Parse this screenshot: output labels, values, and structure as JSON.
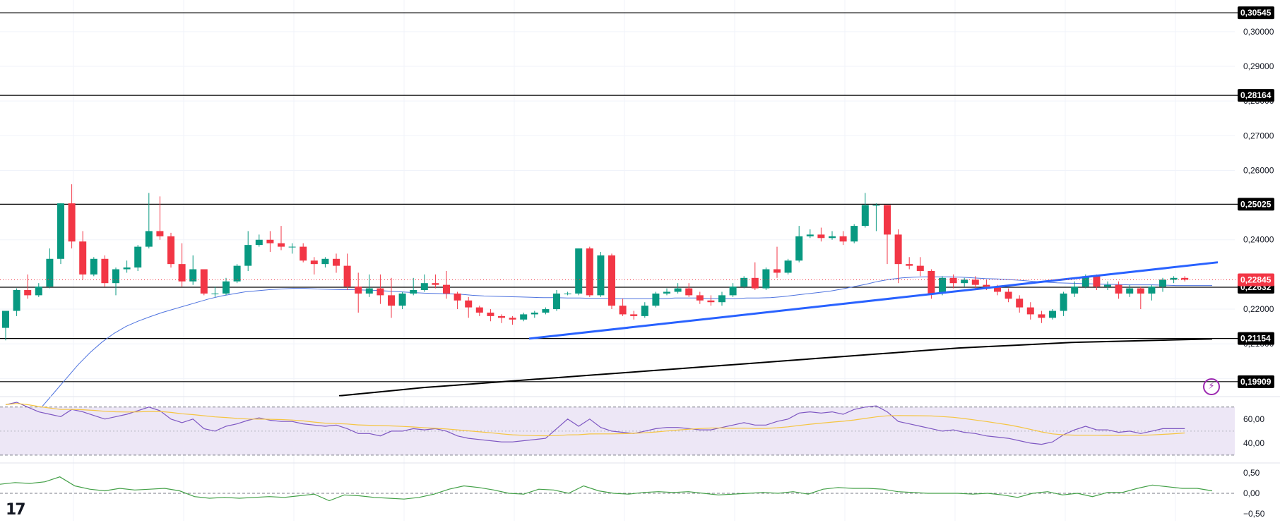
{
  "chart_data": {
    "type": "candlestick",
    "price_axis": {
      "ticks": [
        "0,30000",
        "0,29000",
        "0,28000",
        "0,27000",
        "0,26000",
        "0,24000",
        "0,22000",
        "0,21000",
        "0,20000"
      ],
      "range": [
        0.196,
        0.3075
      ]
    },
    "levels": [
      {
        "label": "0,30545",
        "value": 0.30545
      },
      {
        "label": "0,28164",
        "value": 0.28164
      },
      {
        "label": "0,25025",
        "value": 0.25025
      },
      {
        "label": "0,22632",
        "value": 0.22632
      },
      {
        "label": "0,21154",
        "value": 0.21154
      },
      {
        "label": "0,19909",
        "value": 0.19909
      }
    ],
    "current_price": {
      "label": "0,22845",
      "value": 0.22845
    },
    "candles": [
      [
        0.2146,
        0.2195,
        0.211,
        0.2195
      ],
      [
        0.2195,
        0.2255,
        0.218,
        0.226
      ],
      [
        0.2255,
        0.224,
        0.223,
        0.23
      ],
      [
        0.224,
        0.2265,
        0.2235,
        0.2275
      ],
      [
        0.2265,
        0.2345,
        0.226,
        0.2375
      ],
      [
        0.2345,
        0.2505,
        0.233,
        0.2505
      ],
      [
        0.2505,
        0.2395,
        0.2375,
        0.256
      ],
      [
        0.2395,
        0.23,
        0.2285,
        0.2425
      ],
      [
        0.23,
        0.2345,
        0.2295,
        0.235
      ],
      [
        0.2345,
        0.2275,
        0.2265,
        0.2355
      ],
      [
        0.2275,
        0.2315,
        0.224,
        0.232
      ],
      [
        0.2315,
        0.232,
        0.2305,
        0.234
      ],
      [
        0.232,
        0.238,
        0.231,
        0.2385
      ],
      [
        0.238,
        0.2425,
        0.2375,
        0.2535
      ],
      [
        0.2425,
        0.241,
        0.24,
        0.2525
      ],
      [
        0.241,
        0.233,
        0.232,
        0.242
      ],
      [
        0.233,
        0.228,
        0.2265,
        0.239
      ],
      [
        0.228,
        0.2315,
        0.227,
        0.2355
      ],
      [
        0.2315,
        0.2245,
        0.224,
        0.231
      ],
      [
        0.2245,
        0.2245,
        0.2235,
        0.2265
      ],
      [
        0.2245,
        0.228,
        0.224,
        0.229
      ],
      [
        0.228,
        0.2325,
        0.2275,
        0.233
      ],
      [
        0.2325,
        0.2385,
        0.231,
        0.2425
      ],
      [
        0.2385,
        0.24,
        0.238,
        0.2415
      ],
      [
        0.24,
        0.239,
        0.2365,
        0.2425
      ],
      [
        0.239,
        0.238,
        0.237,
        0.244
      ],
      [
        0.238,
        0.238,
        0.236,
        0.239
      ],
      [
        0.238,
        0.234,
        0.2335,
        0.239
      ],
      [
        0.234,
        0.233,
        0.23,
        0.235
      ],
      [
        0.233,
        0.2345,
        0.232,
        0.235
      ],
      [
        0.2345,
        0.2325,
        0.2305,
        0.236
      ],
      [
        0.2325,
        0.2265,
        0.2255,
        0.236
      ],
      [
        0.2265,
        0.2245,
        0.219,
        0.2305
      ],
      [
        0.2245,
        0.226,
        0.2235,
        0.23
      ],
      [
        0.226,
        0.224,
        0.2215,
        0.23
      ],
      [
        0.224,
        0.221,
        0.2175,
        0.229
      ],
      [
        0.221,
        0.2245,
        0.22,
        0.225
      ],
      [
        0.2245,
        0.2255,
        0.224,
        0.229
      ],
      [
        0.2255,
        0.2275,
        0.225,
        0.23
      ],
      [
        0.2275,
        0.227,
        0.226,
        0.23
      ],
      [
        0.227,
        0.2245,
        0.223,
        0.231
      ],
      [
        0.2245,
        0.2225,
        0.22,
        0.225
      ],
      [
        0.2225,
        0.2205,
        0.2175,
        0.2235
      ],
      [
        0.2205,
        0.219,
        0.218,
        0.221
      ],
      [
        0.219,
        0.218,
        0.2165,
        0.22
      ],
      [
        0.218,
        0.2175,
        0.216,
        0.2185
      ],
      [
        0.2175,
        0.217,
        0.2155,
        0.218
      ],
      [
        0.217,
        0.2185,
        0.2165,
        0.219
      ],
      [
        0.2185,
        0.219,
        0.2175,
        0.2195
      ],
      [
        0.219,
        0.22,
        0.2185,
        0.2205
      ],
      [
        0.22,
        0.2245,
        0.2195,
        0.2255
      ],
      [
        0.2245,
        0.2245,
        0.224,
        0.225
      ],
      [
        0.2245,
        0.2375,
        0.224,
        0.2375
      ],
      [
        0.2375,
        0.224,
        0.2235,
        0.238
      ],
      [
        0.224,
        0.2355,
        0.2235,
        0.2365
      ],
      [
        0.2355,
        0.221,
        0.22,
        0.236
      ],
      [
        0.221,
        0.2185,
        0.218,
        0.223
      ],
      [
        0.2185,
        0.218,
        0.217,
        0.2195
      ],
      [
        0.218,
        0.221,
        0.2175,
        0.222
      ],
      [
        0.221,
        0.2245,
        0.2205,
        0.225
      ],
      [
        0.2245,
        0.225,
        0.224,
        0.226
      ],
      [
        0.225,
        0.226,
        0.2245,
        0.2275
      ],
      [
        0.226,
        0.224,
        0.2235,
        0.2275
      ],
      [
        0.224,
        0.2225,
        0.2215,
        0.225
      ],
      [
        0.2225,
        0.222,
        0.221,
        0.224
      ],
      [
        0.222,
        0.224,
        0.221,
        0.225
      ],
      [
        0.224,
        0.2265,
        0.2235,
        0.2275
      ],
      [
        0.2265,
        0.229,
        0.226,
        0.2295
      ],
      [
        0.229,
        0.226,
        0.2255,
        0.2335
      ],
      [
        0.226,
        0.2315,
        0.2255,
        0.232
      ],
      [
        0.2315,
        0.2305,
        0.229,
        0.238
      ],
      [
        0.2305,
        0.234,
        0.23,
        0.2345
      ],
      [
        0.234,
        0.241,
        0.2335,
        0.244
      ],
      [
        0.241,
        0.2415,
        0.2405,
        0.243
      ],
      [
        0.2415,
        0.2405,
        0.2395,
        0.2435
      ],
      [
        0.2405,
        0.241,
        0.24,
        0.2425
      ],
      [
        0.241,
        0.2395,
        0.2385,
        0.2425
      ],
      [
        0.2395,
        0.244,
        0.239,
        0.2445
      ],
      [
        0.244,
        0.25,
        0.2435,
        0.2535
      ],
      [
        0.25,
        0.25,
        0.2425,
        0.2505
      ],
      [
        0.25,
        0.2415,
        0.233,
        0.25
      ],
      [
        0.2415,
        0.233,
        0.2275,
        0.243
      ],
      [
        0.233,
        0.2325,
        0.2315,
        0.235
      ],
      [
        0.2325,
        0.231,
        0.2295,
        0.235
      ],
      [
        0.231,
        0.2245,
        0.223,
        0.2315
      ],
      [
        0.2245,
        0.229,
        0.224,
        0.2295
      ],
      [
        0.229,
        0.2275,
        0.226,
        0.23
      ],
      [
        0.2275,
        0.2285,
        0.2265,
        0.229
      ],
      [
        0.2285,
        0.227,
        0.226,
        0.2295
      ],
      [
        0.227,
        0.2265,
        0.2255,
        0.2285
      ],
      [
        0.2265,
        0.225,
        0.224,
        0.227
      ],
      [
        0.225,
        0.223,
        0.222,
        0.226
      ],
      [
        0.223,
        0.2205,
        0.219,
        0.224
      ],
      [
        0.2205,
        0.2185,
        0.217,
        0.222
      ],
      [
        0.2185,
        0.2175,
        0.216,
        0.2195
      ],
      [
        0.2175,
        0.2195,
        0.217,
        0.22
      ],
      [
        0.2195,
        0.2245,
        0.218,
        0.225
      ],
      [
        0.2245,
        0.2265,
        0.2235,
        0.228
      ],
      [
        0.2265,
        0.2295,
        0.226,
        0.23
      ],
      [
        0.2295,
        0.2265,
        0.2255,
        0.23
      ],
      [
        0.2265,
        0.227,
        0.2255,
        0.228
      ],
      [
        0.227,
        0.2245,
        0.223,
        0.228
      ],
      [
        0.2245,
        0.226,
        0.2235,
        0.227
      ],
      [
        0.226,
        0.2245,
        0.22,
        0.2265
      ],
      [
        0.2245,
        0.2265,
        0.2225,
        0.227
      ],
      [
        0.2265,
        0.2285,
        0.225,
        0.229
      ],
      [
        0.2285,
        0.229,
        0.2275,
        0.2295
      ],
      [
        0.229,
        0.2285,
        0.228,
        0.2295
      ]
    ],
    "sma_blue": {
      "color": "#4e73df",
      "values": [
        0.192,
        0.196,
        0.2,
        0.204,
        0.2075,
        0.2105,
        0.213,
        0.215,
        0.2165,
        0.2178,
        0.219,
        0.22,
        0.221,
        0.222,
        0.223,
        0.2238,
        0.2244,
        0.225,
        0.2253,
        0.2256,
        0.2258,
        0.226,
        0.226,
        0.2258,
        0.2257,
        0.2256,
        0.2256,
        0.2255,
        0.2254,
        0.2252,
        0.225,
        0.2248,
        0.2246,
        0.2245,
        0.2244,
        0.2243,
        0.224,
        0.2238,
        0.2237,
        0.2236,
        0.2235,
        0.2234,
        0.2233,
        0.2233,
        0.2232,
        0.2232,
        0.2231,
        0.2231,
        0.223,
        0.223,
        0.223,
        0.223,
        0.223,
        0.2232,
        0.2232,
        0.2232,
        0.223,
        0.223,
        0.223,
        0.2232,
        0.2232,
        0.2233,
        0.2236,
        0.224,
        0.2244,
        0.2248,
        0.2252,
        0.2258,
        0.2265,
        0.2272,
        0.228,
        0.2286,
        0.229,
        0.2292,
        0.2293,
        0.2293,
        0.2293,
        0.2292,
        0.229,
        0.2288,
        0.2287,
        0.2285,
        0.2283,
        0.228,
        0.2278,
        0.2276,
        0.2275,
        0.2274,
        0.2273,
        0.2272,
        0.2271,
        0.227,
        0.227,
        0.227,
        0.2269,
        0.2268,
        0.2268,
        0.2268,
        0.2268
      ]
    },
    "sma_black": {
      "color": "#000000",
      "values": [
        0.195,
        0.1958,
        0.1966,
        0.1974,
        0.198,
        0.1986,
        0.1992,
        0.1998,
        0.2004,
        0.201,
        0.2016,
        0.2022,
        0.2028,
        0.2034,
        0.204,
        0.2046,
        0.2052,
        0.2058,
        0.2064,
        0.207,
        0.2076,
        0.2082,
        0.2088,
        0.2092,
        0.2096,
        0.21,
        0.2104,
        0.2106,
        0.2108,
        0.211,
        0.2112,
        0.2114
      ]
    },
    "trendline": {
      "color": "#2962ff",
      "start": {
        "candle": 47.5,
        "value": 0.2115
      },
      "end": {
        "candle": 110.0,
        "value": 0.2335
      }
    },
    "rsi": {
      "ticks": [
        "60,00",
        "40,00"
      ],
      "range": [
        27,
        74
      ],
      "bands": [
        70,
        30
      ],
      "mid": 50,
      "line_color": "#7e57c2",
      "signal_color": "#f5c542",
      "values": [
        72,
        74,
        70,
        66,
        64,
        62,
        68,
        66,
        63,
        60,
        62,
        64,
        67,
        70,
        67,
        60,
        57,
        60,
        52,
        50,
        54,
        56,
        59,
        61,
        59,
        58,
        58,
        56,
        55,
        54,
        55,
        52,
        48,
        48,
        46,
        50,
        50,
        52,
        51,
        52,
        50,
        46,
        44,
        43,
        42,
        41,
        41,
        42,
        43,
        44,
        52,
        60,
        54,
        60,
        53,
        50,
        49,
        48,
        50,
        52,
        53,
        53,
        52,
        51,
        51,
        53,
        55,
        57,
        55,
        55,
        58,
        60,
        65,
        66,
        65,
        66,
        64,
        68,
        70,
        71,
        66,
        58,
        56,
        54,
        52,
        50,
        51,
        49,
        48,
        46,
        45,
        44,
        42,
        40,
        39,
        41,
        47,
        51,
        54,
        51,
        51,
        49,
        50,
        48,
        50,
        52,
        52,
        52
      ]
    },
    "osc": {
      "ticks": [
        "0,50",
        "0,00",
        "−0,50"
      ],
      "range": [
        -0.6,
        0.6
      ],
      "line_color": "#43a047",
      "values": [
        0.22,
        0.26,
        0.24,
        0.28,
        0.4,
        0.18,
        0.1,
        0.06,
        0.12,
        0.08,
        0.1,
        0.12,
        0.06,
        -0.08,
        -0.12,
        -0.1,
        -0.12,
        -0.1,
        -0.08,
        -0.1,
        -0.06,
        -0.02,
        -0.18,
        -0.04,
        -0.06,
        -0.1,
        -0.12,
        -0.14,
        -0.1,
        -0.02,
        0.1,
        0.18,
        0.14,
        0.08,
        0.0,
        -0.02,
        0.1,
        0.08,
        0.0,
        0.18,
        0.06,
        0.0,
        -0.02,
        0.02,
        0.04,
        0.02,
        0.04,
        0.0,
        -0.04,
        -0.02,
        0.0,
        0.02,
        0.0,
        0.04,
        -0.02,
        0.1,
        0.14,
        0.12,
        0.12,
        0.1,
        0.04,
        0.02,
        0.0,
        0.0,
        0.0,
        -0.02,
        0.0,
        -0.04,
        -0.1,
        0.0,
        0.04,
        -0.04,
        0.0,
        -0.08,
        0.02,
        0.02,
        0.12,
        0.2,
        0.16,
        0.12,
        0.12,
        0.06
      ]
    },
    "colors": {
      "up": "#089981",
      "down": "#f23645",
      "axis_text": "#131722",
      "grid": "#f0f3fa",
      "rsi_fill": "#ede7f6"
    }
  },
  "ui": {
    "logo_text": "17"
  }
}
